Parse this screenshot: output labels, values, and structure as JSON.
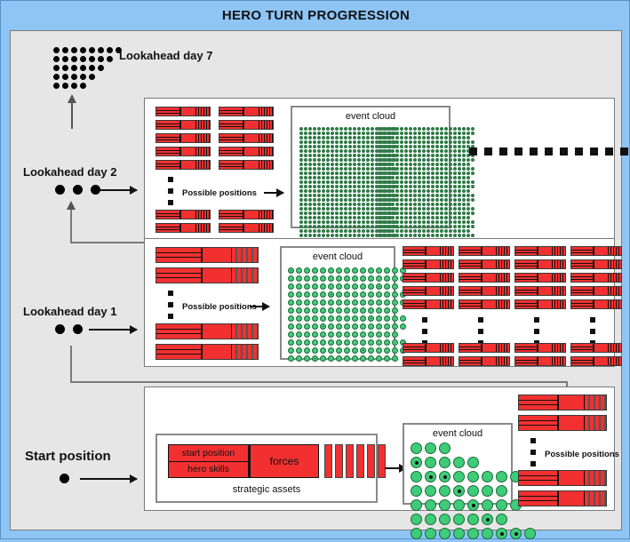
{
  "title": "HERO TURN PROGRESSION",
  "colors": {
    "outer_background": "#8ec5f5",
    "board_background": "#e6e6e6",
    "panel_background": "#ffffff",
    "hero_bar_red": "#f23030",
    "event_dot_green": "#3ecc78",
    "border_gray": "#7a7a7a"
  },
  "stages": [
    {
      "id": "lookahead-day-7",
      "label": "Lookahead day 7",
      "dot_count": 0,
      "dot_cluster_rows": [
        8,
        7,
        6,
        5,
        4
      ]
    },
    {
      "id": "lookahead-day-2",
      "label": "Lookahead day 2",
      "dot_count": 3,
      "possible_positions_label": "Possible positions",
      "event_cloud_label": "event cloud",
      "bar_columns": 2,
      "bars_above": 5,
      "bars_below": 2,
      "trailing_squares": 12
    },
    {
      "id": "lookahead-day-1",
      "label": "Lookahead day 1",
      "dot_count": 2,
      "possible_positions_label": "Possible positions",
      "event_cloud_label": "event cloud",
      "bars_above": 2,
      "bars_below": 2,
      "right_columns": 4,
      "right_bars_above": 5,
      "right_bars_below": 2
    },
    {
      "id": "start-position",
      "label": "Start position",
      "dot_count": 1,
      "possible_positions_label": "Possible positions",
      "event_cloud_label": "event cloud",
      "strategic_assets_label": "strategic assets",
      "asset_cells": [
        "start position",
        "hero skills"
      ],
      "forces_label": "forces",
      "force_bar_count": 6,
      "bars_above": 2,
      "bars_below": 2
    }
  ],
  "event_clouds": {
    "day7_day2": {
      "block_rows": 27,
      "block_cols": 22,
      "blocks": 2,
      "dot_size": "tiny"
    },
    "day1": {
      "rows": 12,
      "cols": 15,
      "dot_size": "small"
    },
    "start": {
      "rows": [
        3,
        5,
        8,
        7,
        8,
        7,
        9
      ],
      "dot_size": "large",
      "filled_centers": [
        [
          1,
          0
        ],
        [
          2,
          1
        ],
        [
          2,
          2
        ],
        [
          3,
          3
        ],
        [
          4,
          4
        ],
        [
          5,
          5
        ],
        [
          6,
          6
        ],
        [
          6,
          7
        ]
      ]
    }
  }
}
